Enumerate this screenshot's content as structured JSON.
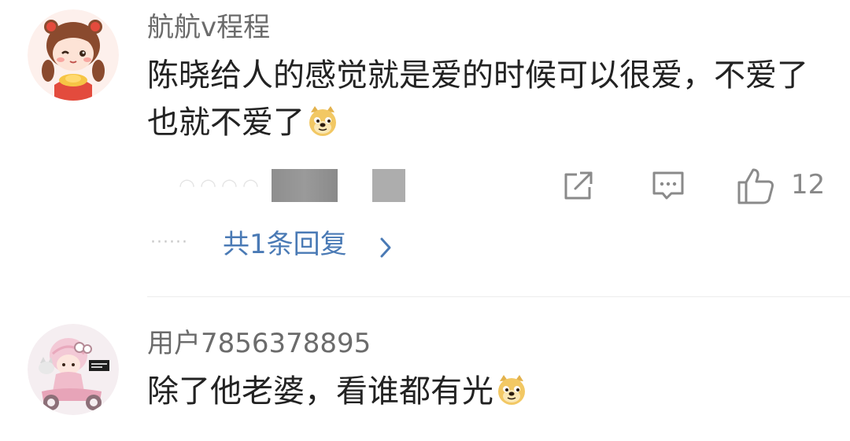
{
  "comments": [
    {
      "username": "航航v程程",
      "text": "陈晓给人的感觉就是爱的时候可以很爱，不爱了也就不爱了",
      "emoji": "doge-emoji",
      "like_count": "12",
      "reply_dots": "······",
      "reply_label": "共1条回复"
    },
    {
      "username": "用户7856378895",
      "text": "除了他老婆，看谁都有光",
      "emoji": "doge-emoji"
    }
  ],
  "icons": {
    "share": "share-icon",
    "comment": "comment-icon",
    "like": "thumbs-up-icon",
    "chevron": "chevron-right-icon"
  },
  "colors": {
    "username": "#6b6b6b",
    "text": "#222222",
    "link": "#4a7ab5",
    "icon": "#888888"
  }
}
